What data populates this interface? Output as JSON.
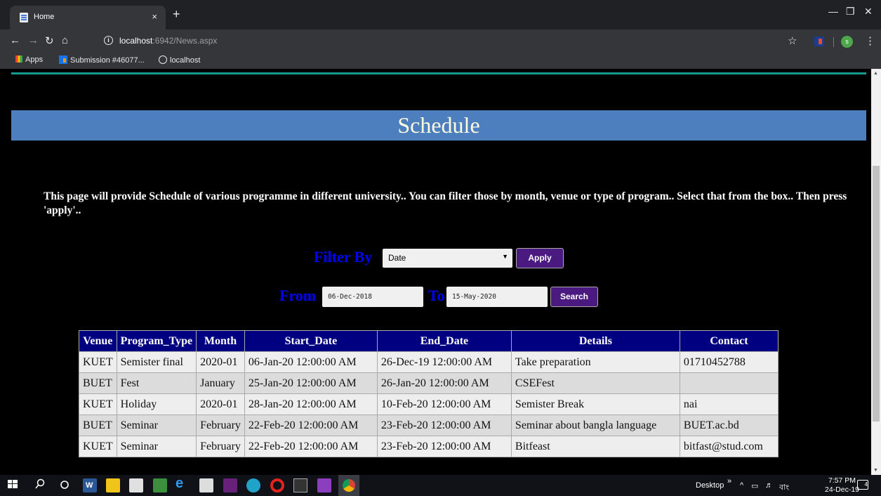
{
  "browser": {
    "tab_title": "Home",
    "tab_close": "×",
    "new_tab": "+",
    "url_host": "localhost",
    "url_rest": ":6942/News.aspx",
    "bookmarks": [
      "Apps",
      "Submission #46077...",
      "localhost"
    ],
    "profile_initial": "s"
  },
  "page": {
    "banner_title": "Schedule",
    "intro_text": "This page will provide Schedule of various programme in different university.. You can filter those by month, venue or type of program.. Select that from the box.. Then press 'apply'..",
    "filter": {
      "label": "Filter By",
      "selected": "Date",
      "apply_label": "Apply"
    },
    "range": {
      "from_label": "From",
      "from_value": "06-Dec-2018",
      "to_label": "To",
      "to_value": "15-May-2020",
      "search_label": "Search"
    },
    "table": {
      "headers": [
        "Venue",
        "Program_Type",
        "Month",
        "Start_Date",
        "End_Date",
        "Details",
        "Contact"
      ],
      "rows": [
        [
          "KUET",
          "Semister final",
          "2020-01",
          "06-Jan-20 12:00:00 AM",
          "26-Dec-19 12:00:00 AM",
          "Take preparation",
          "01710452788"
        ],
        [
          "BUET",
          "Fest",
          "January",
          "25-Jan-20 12:00:00 AM",
          "26-Jan-20 12:00:00 AM",
          "CSEFest",
          ""
        ],
        [
          "KUET",
          "Holiday",
          "2020-01",
          "28-Jan-20 12:00:00 AM",
          "10-Feb-20 12:00:00 AM",
          "Semister Break",
          "nai"
        ],
        [
          "BUET",
          "Seminar",
          "February",
          "22-Feb-20 12:00:00 AM",
          "23-Feb-20 12:00:00 AM",
          "Seminar about bangla language",
          "BUET.ac.bd"
        ],
        [
          "KUET",
          "Seminar",
          "February",
          "22-Feb-20 12:00:00 AM",
          "23-Feb-20 12:00:00 AM",
          "Bitfeast",
          "bitfast@stud.com"
        ]
      ]
    }
  },
  "taskbar": {
    "desktop_label": "Desktop",
    "lang": "বাং",
    "time": "7:57 PM",
    "date": "24-Dec-19",
    "notif_count": "4"
  }
}
